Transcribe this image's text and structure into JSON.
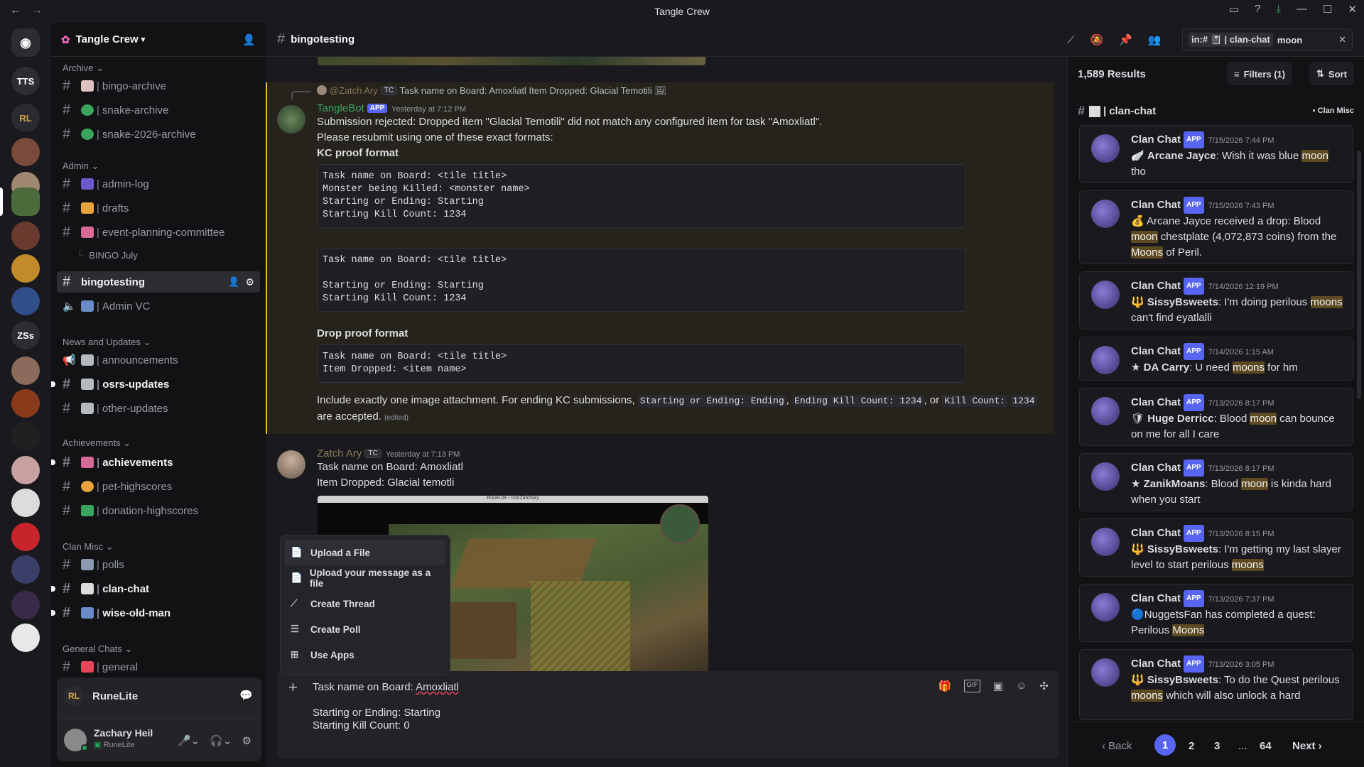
{
  "window": {
    "title": "Tangle Crew"
  },
  "server": {
    "name": "Tangle Crew"
  },
  "guilds": [
    {
      "label": "TTS"
    },
    {
      "label": "ZSs"
    }
  ],
  "categories": {
    "archive": "Archive",
    "admin": "Admin",
    "news": "News and Updates",
    "achievements": "Achievements",
    "clan_misc": "Clan Misc",
    "general": "General Chats"
  },
  "channels": {
    "bingo_archive": "bingo-archive",
    "snake_archive": "snake-archive",
    "snake_2026": "snake-2026-archive",
    "admin_log": "admin-log",
    "drafts": "drafts",
    "event_planning": "event-planning-committee",
    "bingo_july": "BINGO July",
    "bingotesting": "bingotesting",
    "admin_vc": "Admin VC",
    "announcements": "announcements",
    "osrs_updates": "osrs-updates",
    "other_updates": "other-updates",
    "achievements": "achievements",
    "pet_highscores": "pet-highscores",
    "donation_highscores": "donation-highscores",
    "polls": "polls",
    "clan_chat": "clan-chat",
    "wise_old_man": "wise-old-man",
    "general": "general"
  },
  "app_panel": {
    "name": "RuneLite"
  },
  "user": {
    "name": "Zachary Heil",
    "status": "RuneLite"
  },
  "header": {
    "channel": "bingotesting",
    "search_scope": "in:# 📓 | clan-chat",
    "search_query": "moon"
  },
  "messages": {
    "reply": {
      "name": "@Zatch Ary",
      "tag": "TC",
      "text": "Task name on Board: Amoxliatl Item Dropped: Glacial Temotili"
    },
    "bot": {
      "name": "TangleBot",
      "badge": "APP",
      "time": "Yesterday at 7:12 PM",
      "line1": "Submission rejected: Dropped item \"Glacial Temotili\" did not match any configured item for task \"Amoxliatl\".",
      "line2": "Please resubmit using one of these exact formats:",
      "kc_heading": "KC proof format",
      "code1": "Task name on Board: <tile title>\nMonster being Killed: <monster name>\nStarting or Ending: Starting\nStarting Kill Count: 1234",
      "code2": "Task name on Board: <tile title>\n\nStarting or Ending: Starting\nStarting Kill Count: 1234",
      "drop_heading": "Drop proof format",
      "code3": "Task name on Board: <tile title>\nItem Dropped: <item name>",
      "footer_a": "Include exactly one image attachment. For ending KC submissions,",
      "code_a": "Starting or Ending: Ending",
      "code_b": "Ending Kill Count: 1234",
      "footer_or": ", or",
      "code_c": "Kill Count:",
      "code_d": "1234",
      "footer_b": "are accepted.",
      "edited": "(edited)"
    },
    "zatch": {
      "name": "Zatch Ary",
      "tag": "TC",
      "time": "Yesterday at 7:13 PM",
      "line1": "Task name on Board: Amoxliatl",
      "line2": "Item Dropped: Glacial temotli",
      "image_title": "RuneLite - IronZatchary"
    }
  },
  "popup": {
    "items": [
      "Upload a File",
      "Upload your message as a file",
      "Create Thread",
      "Create Poll",
      "Use Apps"
    ]
  },
  "composer": {
    "line1": "Task name on Board: ",
    "line1b": "Amoxliatl",
    "line3": "Starting or Ending: Starting",
    "line4": "Starting Kill Count: 0"
  },
  "search": {
    "results": "1,589 Results",
    "filters": "Filters (1)",
    "sort": "Sort",
    "channel": "clan-chat",
    "category": "Clan Misc",
    "items": [
      {
        "author": "Clan Chat",
        "badge": "APP",
        "time": "7/15/2026 7:44 PM",
        "who": "Arcane Jayce",
        "pre": ": Wish it was blue ",
        "hl": "moon",
        "post": " tho"
      },
      {
        "author": "Clan Chat",
        "badge": "APP",
        "time": "7/15/2026 7:43 PM",
        "pre": "Arcane Jayce received a drop: Blood ",
        "hl": "moon",
        "post": " chestplate (4,072,873 coins) from the ",
        "hl2": "Moons",
        "post2": " of Peril."
      },
      {
        "author": "Clan Chat",
        "badge": "APP",
        "time": "7/14/2026 12:19 PM",
        "who": "SissyBsweets",
        "pre": ": I'm doing perilous ",
        "hl": "moons",
        "post": " can't find eyatlalli"
      },
      {
        "author": "Clan Chat",
        "badge": "APP",
        "time": "7/14/2026 1:15 AM",
        "who": "DA Carry",
        "pre": ": U need ",
        "hl": "moons",
        "post": " for hm"
      },
      {
        "author": "Clan Chat",
        "badge": "APP",
        "time": "7/13/2026 8:17 PM",
        "who": "Huge Derricc",
        "pre": ": Blood ",
        "hl": "moon",
        "post": " can bounce on me for all I care"
      },
      {
        "author": "Clan Chat",
        "badge": "APP",
        "time": "7/13/2026 8:17 PM",
        "who": "ZanikMoans",
        "pre": ": Blood ",
        "hl": "moon",
        "post": " is kinda hard when you start"
      },
      {
        "author": "Clan Chat",
        "badge": "APP",
        "time": "7/13/2026 8:15 PM",
        "who": "SissyBsweets",
        "pre": ": I'm getting my last slayer level to start perilous ",
        "hl": "moons",
        "post": ""
      },
      {
        "author": "Clan Chat",
        "badge": "APP",
        "time": "7/13/2026 7:37 PM",
        "pre": "NuggetsFan has completed a quest: Perilous ",
        "hl": "Moons",
        "post": ""
      },
      {
        "author": "Clan Chat",
        "badge": "APP",
        "time": "7/13/2026 3:05 PM",
        "who": "SissyBsweets",
        "pre": ": To do the Quest perilous ",
        "hl": "moons",
        "post": " which will also unlock a hard"
      }
    ],
    "pager": {
      "back": "Back",
      "p1": "1",
      "p2": "2",
      "p3": "3",
      "ellipsis": "...",
      "last": "64",
      "next": "Next"
    }
  }
}
